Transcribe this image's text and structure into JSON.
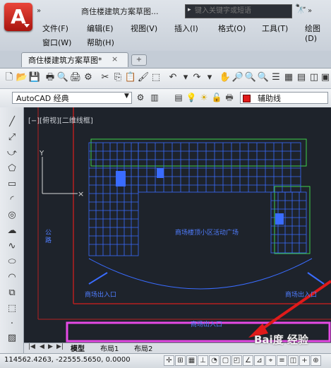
{
  "app": {
    "logo": "A",
    "document_title": "商住楼建筑方案草图..."
  },
  "search": {
    "placeholder": "键入关键字或短语"
  },
  "menus": {
    "row1": [
      "文件(F)",
      "编辑(E)",
      "视图(V)",
      "插入(I)",
      "格式(O)",
      "工具(T)",
      "绘图(D)"
    ],
    "row2": [
      "窗口(W)",
      "帮助(H)"
    ]
  },
  "tabs": {
    "active": "商住楼建筑方案草图*"
  },
  "toolbar2": {
    "workspace": "AutoCAD 经典",
    "layer": "辅助线"
  },
  "viewport": {
    "label": "[−][俯视][二维线框]"
  },
  "drawing": {
    "plaza": "商场楼顶小区活动广场",
    "entrance_left": "商场出入口",
    "entrance_right": "商场出入口",
    "bottom": "商场出入口",
    "vertical": "公路"
  },
  "layout_tabs": [
    "模型",
    "布局1",
    "布局2"
  ],
  "status": {
    "coords": "114562.4263, -22555.5650, 0.0000"
  },
  "watermark": "Bai度 经验",
  "colors": {
    "canvas": "#1e232b",
    "building": "#3a6cff",
    "outline_green": "#3fd14a",
    "magenta": "#e64ae6",
    "arrow": "#e01a1a"
  },
  "icons": {
    "binoculars": "binoculars-icon"
  }
}
